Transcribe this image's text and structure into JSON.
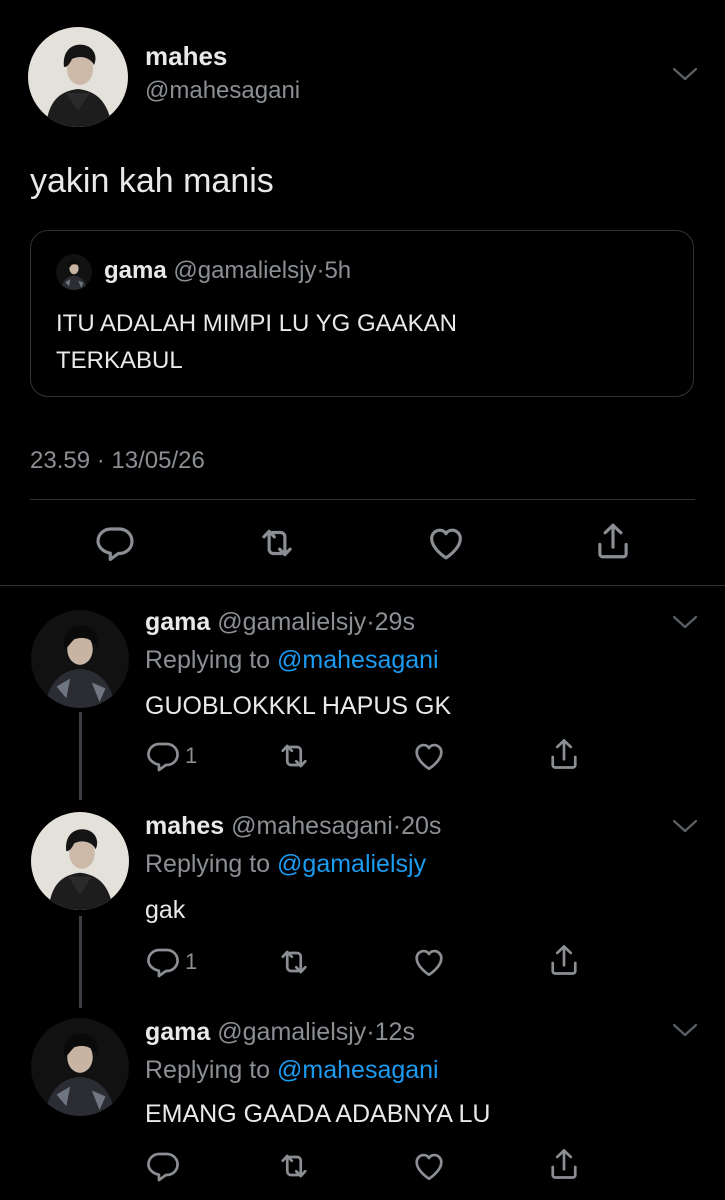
{
  "main_tweet": {
    "author_name": "mahes",
    "author_handle": "@mahesagani",
    "text": "yakin kah manis",
    "quote": {
      "author_name": "gama",
      "author_handle": "@gamalielsjy",
      "time": "5h",
      "text_line1": "ITU ADALAH MIMPI LU YG GAAKAN",
      "text_line2": "TERKABUL"
    },
    "timestamp": "23.59 · 13/05/26"
  },
  "replies": [
    {
      "author_name": "gama",
      "author_handle": "@gamalielsjy",
      "time": "29s",
      "replying_prefix": "Replying to",
      "replying_to": "@mahesagani",
      "text": "GUOBLOKKKL HAPUS GK",
      "reply_count": "1"
    },
    {
      "author_name": "mahes",
      "author_handle": "@mahesagani",
      "time": "20s",
      "replying_prefix": "Replying to",
      "replying_to": "@gamalielsjy",
      "text": "gak",
      "reply_count": "1"
    },
    {
      "author_name": "gama",
      "author_handle": "@gamalielsjy",
      "time": "12s",
      "replying_prefix": "Replying to",
      "replying_to": "@mahesagani",
      "text": "EMANG GAADA ADABNYA LU",
      "reply_count": ""
    }
  ],
  "colors": {
    "background": "#000000",
    "text_primary": "#e7e9ea",
    "text_secondary": "#8b8f94",
    "link": "#1d9bf0",
    "border": "#2f3336"
  },
  "icons": [
    "reply-icon",
    "retweet-icon",
    "like-icon",
    "share-icon",
    "chevron-down-icon"
  ]
}
